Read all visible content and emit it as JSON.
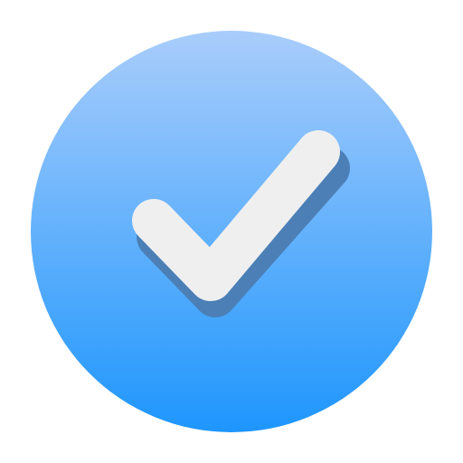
{
  "icon": {
    "name": "checkmark-icon",
    "colors": {
      "circle_top": "#a9cdfb",
      "circle_bottom": "#1e96fd",
      "check_fill": "#efeff0",
      "check_shadow": "#4b7fb6"
    }
  }
}
